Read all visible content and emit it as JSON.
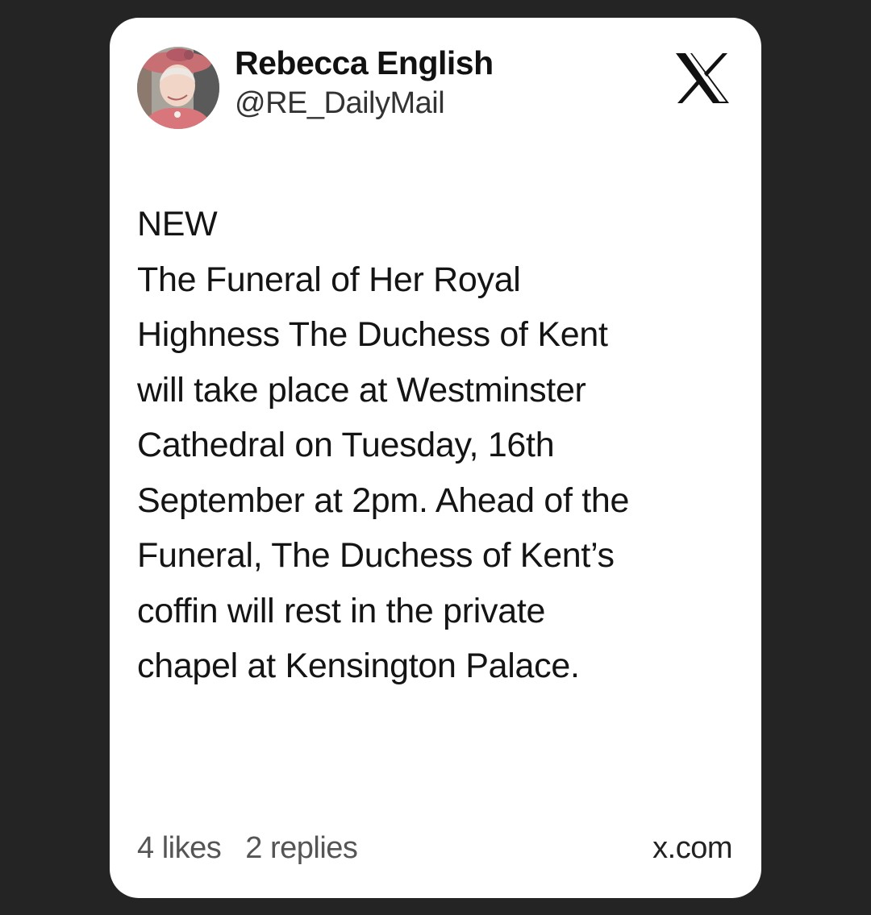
{
  "author": {
    "name": "Rebecca English",
    "handle": "@RE_DailyMail"
  },
  "platform": {
    "logo_icon": "x-logo-icon",
    "source_label": "x.com"
  },
  "tweet": {
    "lines": [
      "NEW",
      "The Funeral of Her Royal",
      "Highness The Duchess of Kent",
      "will take place at Westminster",
      "Cathedral on Tuesday, 16th",
      "September at 2pm.  Ahead of the",
      "Funeral, The Duchess of Kent’s",
      "coffin will rest in the private",
      "chapel at Kensington Palace."
    ]
  },
  "stats": {
    "likes": "4 likes",
    "replies": "2 replies"
  },
  "colors": {
    "background": "#242424",
    "card": "#ffffff",
    "text": "#141414",
    "muted": "#555555"
  }
}
